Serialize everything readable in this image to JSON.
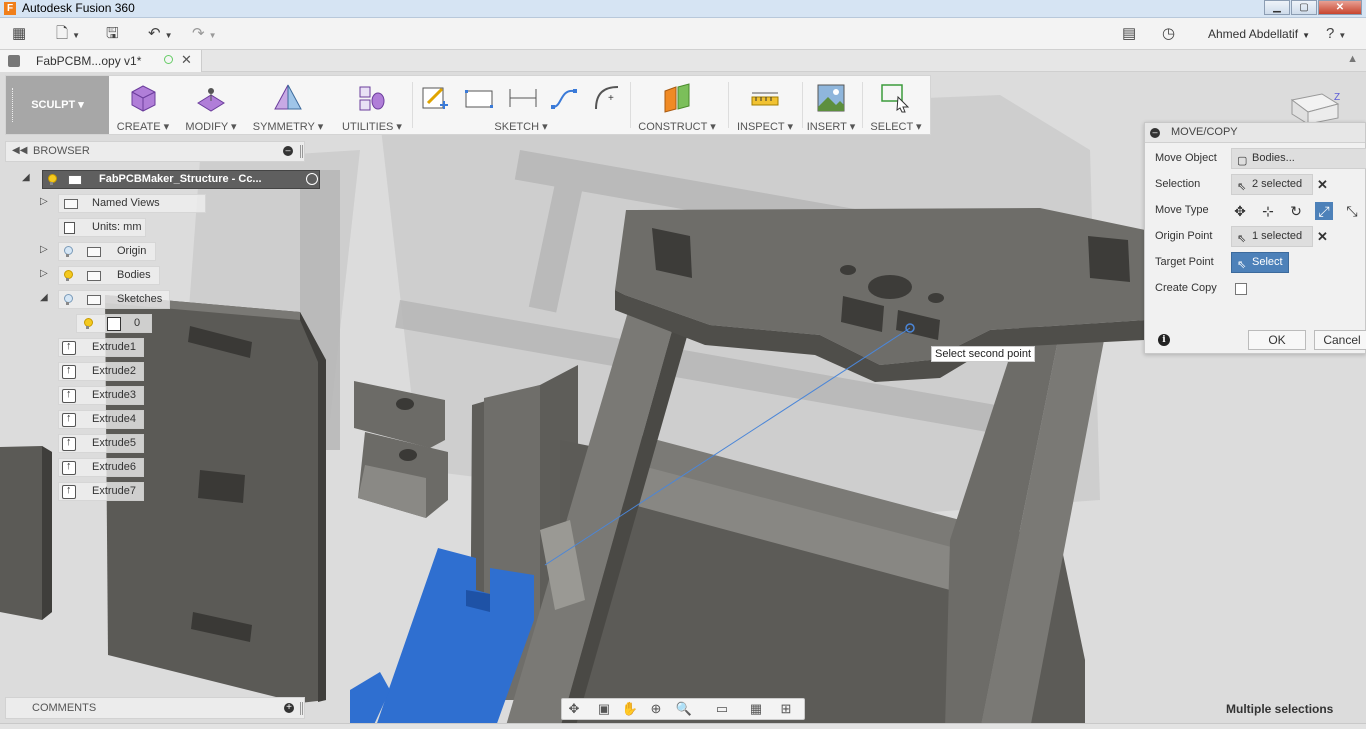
{
  "window": {
    "title": "Autodesk Fusion 360",
    "app_icon": "F"
  },
  "quickbar": {
    "user": "Ahmed Abdellatif",
    "help": "?"
  },
  "document_tab": {
    "name": "FabPCBM...opy v1*"
  },
  "toolbar": {
    "workspace": "SCULPT",
    "groups": [
      "CREATE",
      "MODIFY",
      "SYMMETRY",
      "UTILITIES",
      "SKETCH",
      "CONSTRUCT",
      "INSPECT",
      "INSERT",
      "SELECT"
    ]
  },
  "browser": {
    "title": "BROWSER",
    "root": "FabPCBMaker_Structure - Cc...",
    "items": {
      "named_views": "Named Views",
      "units": "Units: mm",
      "origin": "Origin",
      "bodies": "Bodies",
      "sketches": "Sketches",
      "sketch0": "0"
    },
    "features": [
      "Extrude1",
      "Extrude2",
      "Extrude3",
      "Extrude4",
      "Extrude5",
      "Extrude6",
      "Extrude7"
    ]
  },
  "dialog": {
    "title": "MOVE/COPY",
    "move_object_label": "Move Object",
    "move_object_value": "Bodies...",
    "selection_label": "Selection",
    "selection_value": "2 selected",
    "move_type_label": "Move Type",
    "origin_point_label": "Origin Point",
    "origin_point_value": "1 selected",
    "target_point_label": "Target Point",
    "target_point_value": "Select",
    "create_copy_label": "Create Copy",
    "ok": "OK",
    "cancel": "Cancel"
  },
  "tooltip": "Select second point",
  "comments": {
    "title": "COMMENTS"
  },
  "status": "Multiple selections",
  "colors": {
    "accent_blue": "#4d81b9",
    "selected_body": "#2f6fd0",
    "part_gray": "#6b6a66"
  }
}
